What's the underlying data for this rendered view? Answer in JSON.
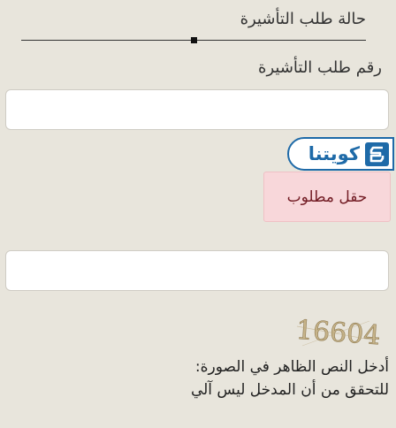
{
  "status": {
    "title": "حالة طلب التأشيرة"
  },
  "visa_request": {
    "label": "رقم طلب التأشيرة",
    "value": ""
  },
  "badge": {
    "text": "كويتنا",
    "logo_icon": "kuwait-logo-icon"
  },
  "alert": {
    "text": "حقل مطلوب"
  },
  "captcha": {
    "value": "",
    "image_text": "16604"
  },
  "instructions": {
    "line1": "أدخل النص الظاهر في الصورة:",
    "line2": "للتحقق من أن المدخل ليس آلي"
  },
  "colors": {
    "background": "#e8e5dc",
    "brand": "#1e6aa8",
    "alert_bg": "#f8d7da",
    "alert_text": "#721c24"
  }
}
